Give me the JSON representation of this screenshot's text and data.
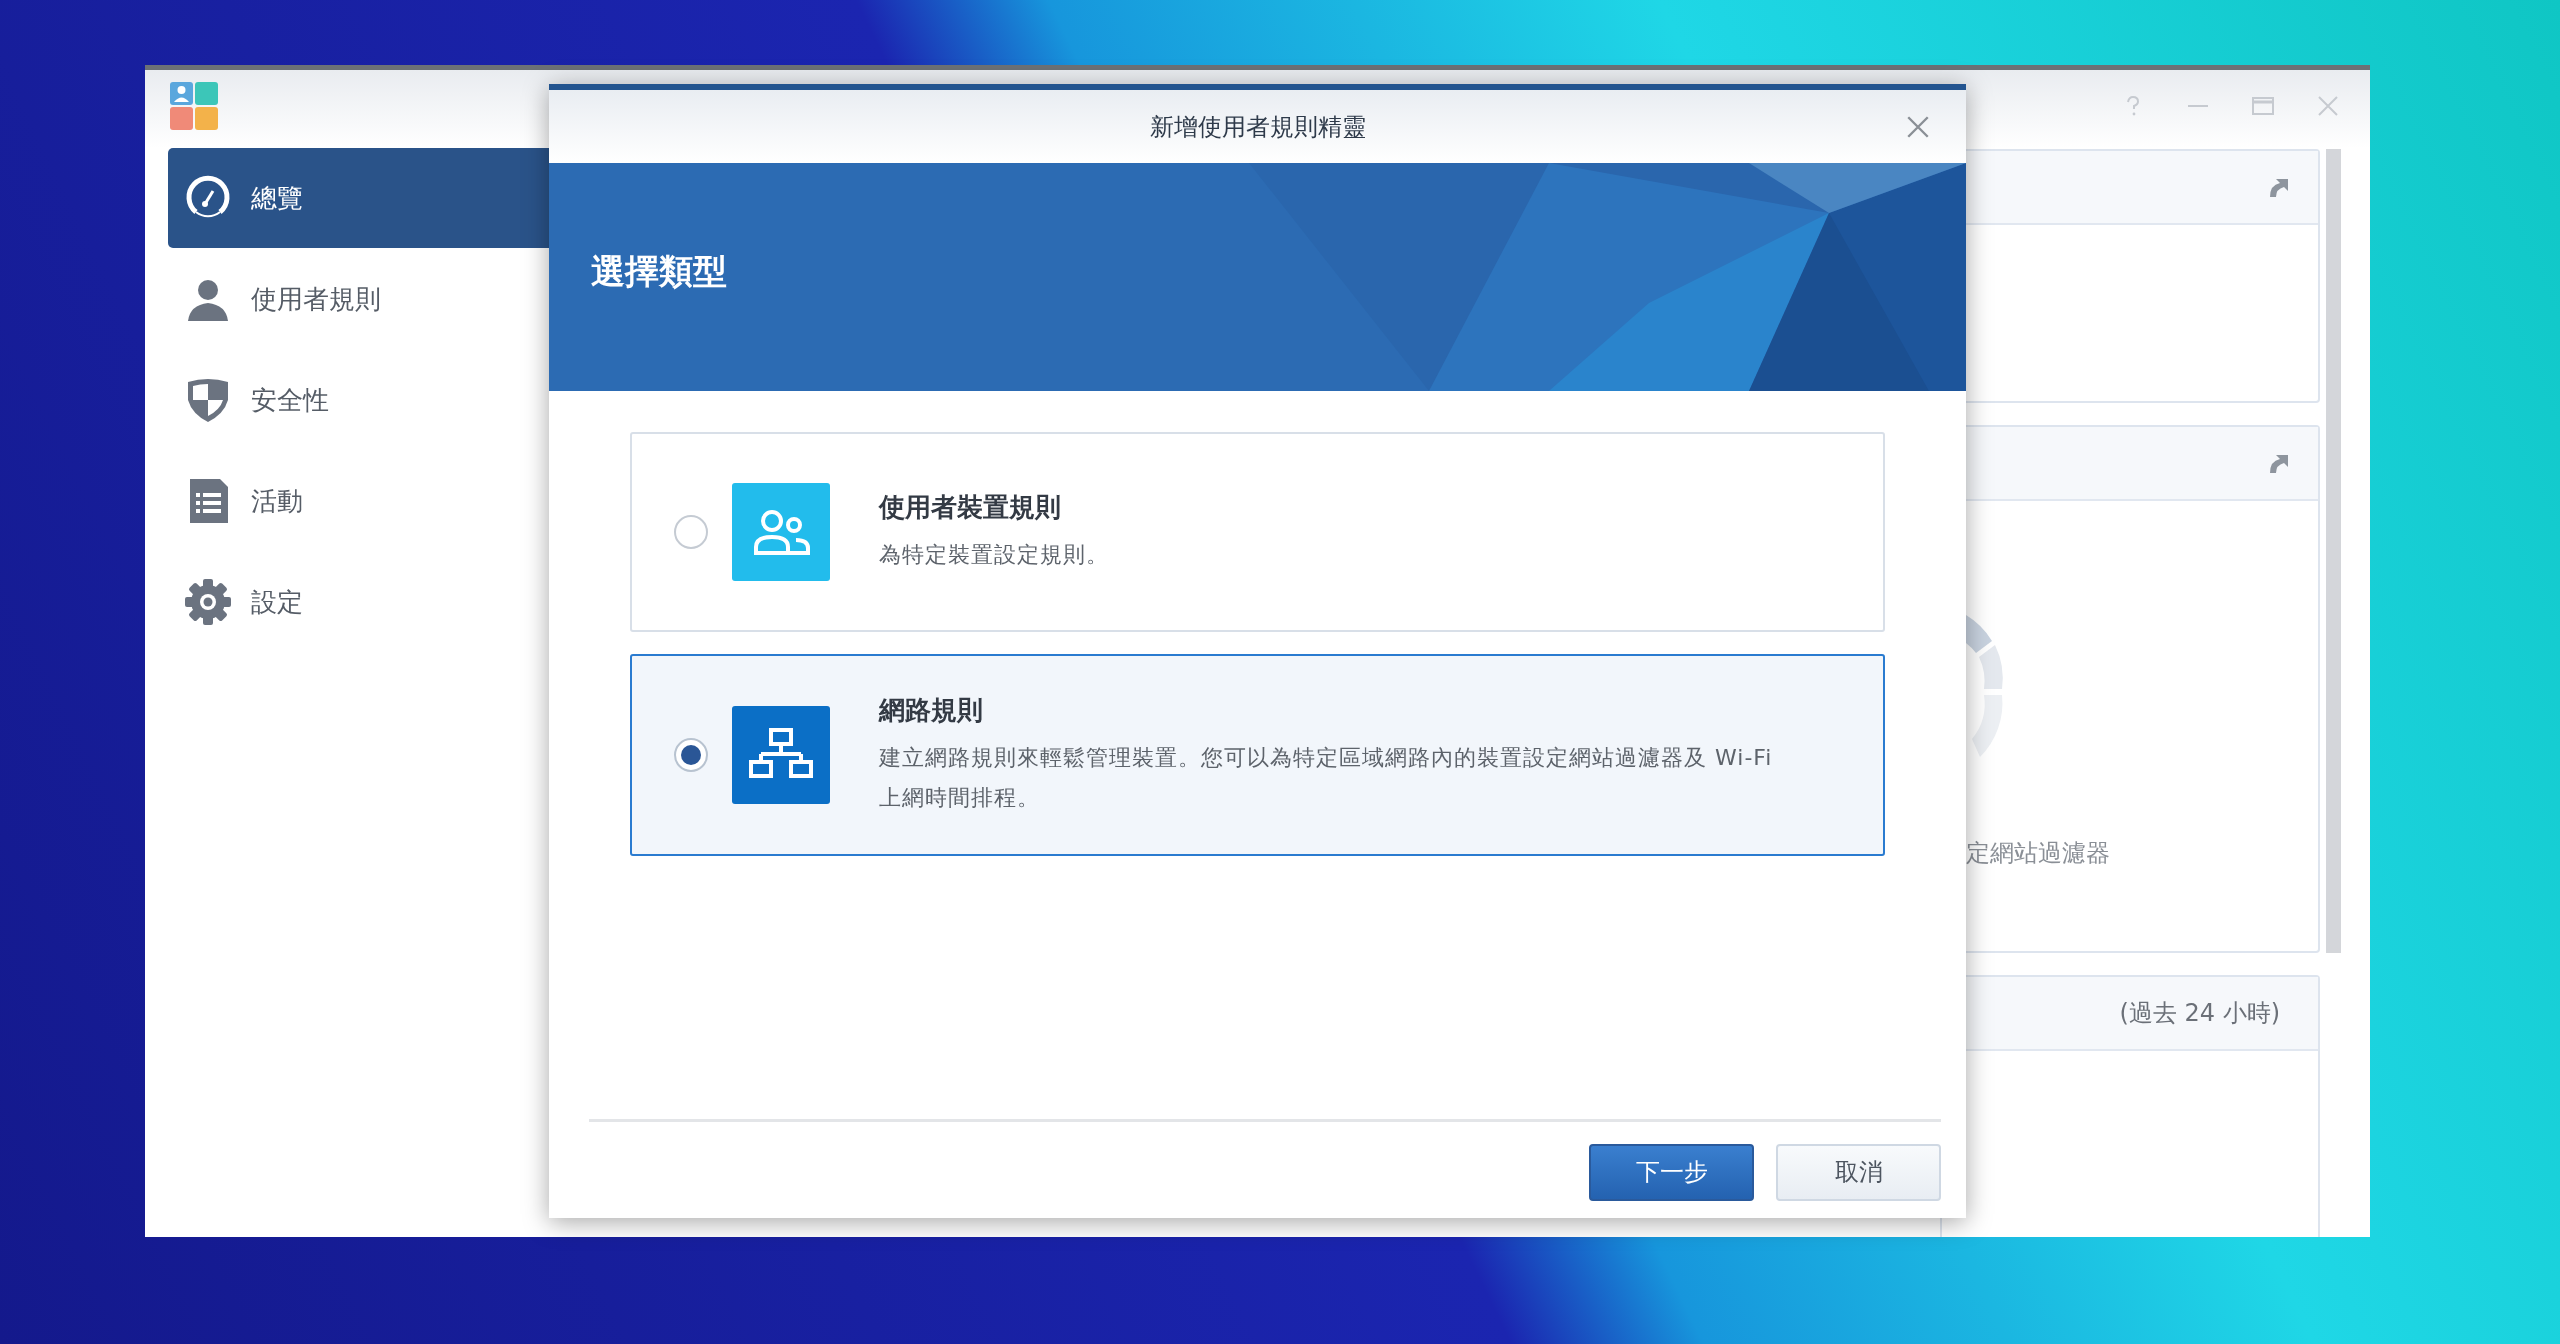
{
  "app_window": {
    "sidebar": {
      "items": [
        {
          "label": "總覽",
          "selected": true
        },
        {
          "label": "使用者規則",
          "selected": false
        },
        {
          "label": "安全性",
          "selected": false
        },
        {
          "label": "活動",
          "selected": false
        },
        {
          "label": "設定",
          "selected": false
        }
      ]
    },
    "panels": [
      {
        "kind": "link"
      },
      {
        "kind": "link",
        "text": "定網站過濾器"
      },
      {
        "kind": "note",
        "header_note": "(過去 24 小時)"
      }
    ]
  },
  "dialog": {
    "title": "新增使用者規則精靈",
    "step_title": "選擇類型",
    "options": [
      {
        "title": "使用者裝置規則",
        "description": "為特定裝置設定規則。",
        "selected": false
      },
      {
        "title": "網路規則",
        "description": "建立網路規則來輕鬆管理裝置。您可以為特定區域網路內的裝置設定網站過濾器及 Wi-Fi 上網時間排程。",
        "selected": true
      }
    ],
    "buttons": [
      {
        "label": "下一步",
        "kind": "primary"
      },
      {
        "label": "取消",
        "kind": "secondary"
      }
    ]
  }
}
